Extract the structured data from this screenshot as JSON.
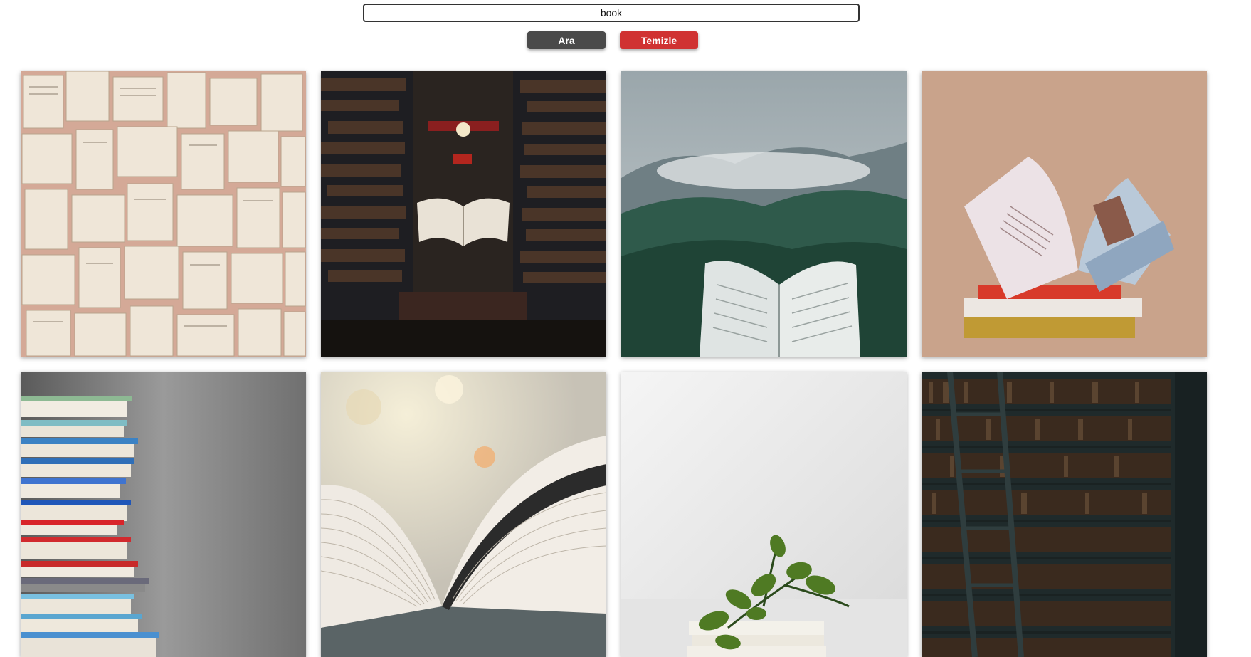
{
  "search": {
    "value": "book",
    "placeholder": ""
  },
  "buttons": {
    "search_label": "Ara",
    "clear_label": "Temizle"
  },
  "colors": {
    "search_button": "#4a4a4a",
    "clear_button": "#d03232"
  },
  "results": [
    {
      "subject": "wall-of-open-book-pages"
    },
    {
      "subject": "floating-book-in-bookstore"
    },
    {
      "subject": "open-book-misty-forest"
    },
    {
      "subject": "open-magazine-on-book-stack"
    },
    {
      "subject": "stack-of-colorful-books"
    },
    {
      "subject": "open-book-closeup"
    },
    {
      "subject": "plant-on-books"
    },
    {
      "subject": "library-shelves-with-ladder"
    }
  ]
}
